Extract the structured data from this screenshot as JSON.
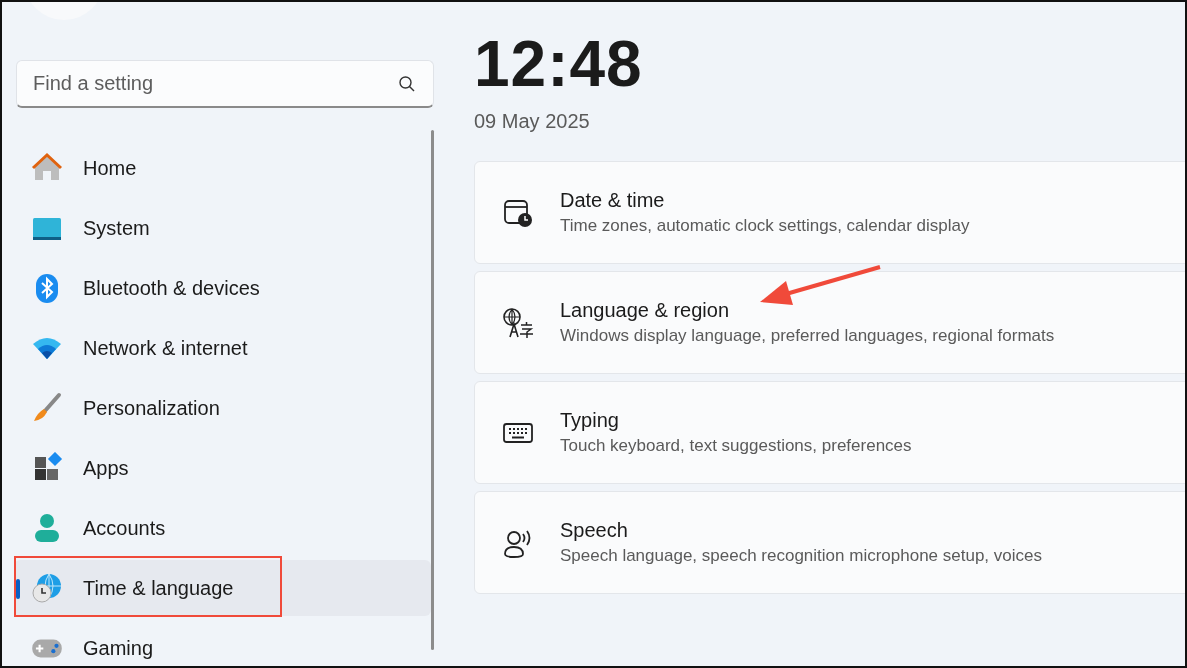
{
  "search": {
    "placeholder": "Find a setting"
  },
  "nav": [
    {
      "label": "Home",
      "selected": false
    },
    {
      "label": "System",
      "selected": false
    },
    {
      "label": "Bluetooth & devices",
      "selected": false
    },
    {
      "label": "Network & internet",
      "selected": false
    },
    {
      "label": "Personalization",
      "selected": false
    },
    {
      "label": "Apps",
      "selected": false
    },
    {
      "label": "Accounts",
      "selected": false
    },
    {
      "label": "Time & language",
      "selected": true
    },
    {
      "label": "Gaming",
      "selected": false
    }
  ],
  "clock": {
    "time": "12:48",
    "date": "09 May 2025"
  },
  "cards": [
    {
      "title": "Date & time",
      "subtitle": "Time zones, automatic clock settings, calendar display"
    },
    {
      "title": "Language & region",
      "subtitle": "Windows display language, preferred languages, regional formats"
    },
    {
      "title": "Typing",
      "subtitle": "Touch keyboard, text suggestions, preferences"
    },
    {
      "title": "Speech",
      "subtitle": "Speech language, speech recognition microphone setup, voices"
    }
  ]
}
